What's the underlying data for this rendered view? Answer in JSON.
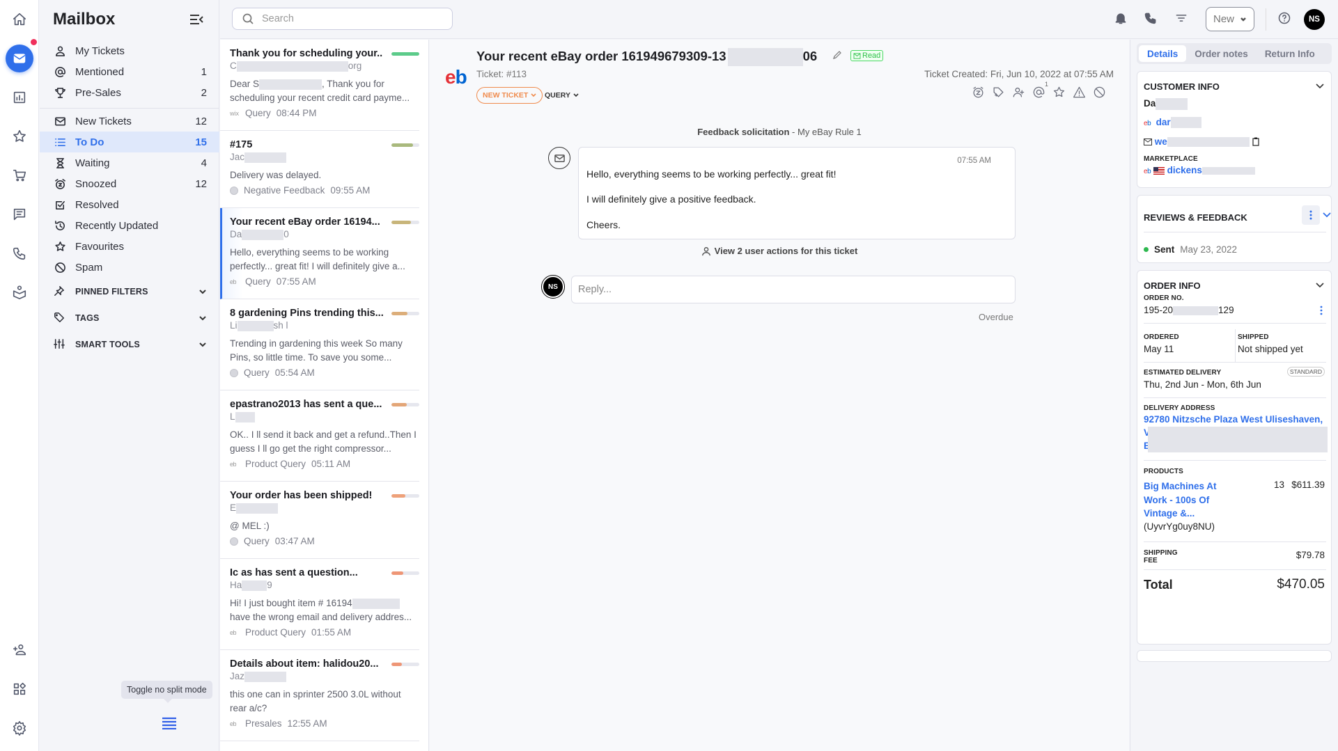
{
  "rail": {
    "items": [
      {
        "name": "home-icon"
      },
      {
        "name": "mailbox-icon",
        "active": true,
        "notification": true
      },
      {
        "name": "reports-icon"
      },
      {
        "name": "reviews-star-icon"
      },
      {
        "name": "cart-icon"
      },
      {
        "name": "chat-icon"
      },
      {
        "name": "phone-icon"
      },
      {
        "name": "knowledge-icon"
      }
    ],
    "bottom": [
      {
        "name": "add-user-icon"
      },
      {
        "name": "apps-icon"
      },
      {
        "name": "settings-icon"
      }
    ]
  },
  "sidebar": {
    "title": "Mailbox",
    "groups": [
      [
        {
          "label": "My Tickets",
          "icon": "user-icon",
          "count": ""
        },
        {
          "label": "Mentioned",
          "icon": "at-icon",
          "count": "1"
        },
        {
          "label": "Pre-Sales",
          "icon": "trophy-icon",
          "count": "2"
        }
      ],
      [
        {
          "label": "New Tickets",
          "icon": "envelope-icon",
          "count": "12"
        },
        {
          "label": "To Do",
          "icon": "list-icon",
          "count": "15",
          "selected": true
        },
        {
          "label": "Waiting",
          "icon": "hourglass-icon",
          "count": "4"
        },
        {
          "label": "Snoozed",
          "icon": "snooze-icon",
          "count": "12"
        },
        {
          "label": "Resolved",
          "icon": "resolved-icon",
          "count": ""
        },
        {
          "label": "Recently Updated",
          "icon": "history-icon",
          "count": ""
        },
        {
          "label": "Favourites",
          "icon": "star-icon",
          "count": ""
        },
        {
          "label": "Spam",
          "icon": "spam-icon",
          "count": ""
        }
      ]
    ],
    "sections": [
      {
        "label": "PINNED FILTERS",
        "icon": "pin-icon"
      },
      {
        "label": "TAGS",
        "icon": "tag-icon"
      },
      {
        "label": "SMART TOOLS",
        "icon": "sliders-icon"
      }
    ],
    "tooltip": "Toggle no split mode"
  },
  "topbar": {
    "search_placeholder": "Search",
    "new_label": "New",
    "avatar_initials": "NS"
  },
  "tickets": [
    {
      "title": "Thank you for scheduling your...",
      "from": "C",
      "from_tail": "org",
      "preview": ", Thank you for scheduling your recent credit card payme...",
      "preview_lead": "Dear S",
      "source": "wix",
      "category": "Query",
      "time": "08:44 PM",
      "priority_color": "#5ccb8a",
      "priority": 1.0
    },
    {
      "title": "#175",
      "from": "Jac",
      "from_tail": "",
      "preview": "Delivery was delayed.",
      "preview_lead": "",
      "source": "globe",
      "category": "Negative Feedback",
      "time": "09:55 AM",
      "priority_color": "#a9b97d",
      "priority": 0.78
    },
    {
      "title": "Your recent eBay order 16194...",
      "from": "Da",
      "from_tail": "0",
      "preview": "Hello, everything seems to be working perfectly... great fit! I will definitely give a...",
      "preview_lead": "",
      "source": "eb",
      "category": "Query",
      "time": "07:55 AM",
      "priority_color": "#c8b57a",
      "priority": 0.7,
      "selected": true
    },
    {
      "title": "8 gardening Pins trending this...",
      "from": "Li",
      "from_tail": "sh l",
      "preview": "Trending in gardening this week So many Pins, so little time. To save you some...",
      "preview_lead": "",
      "source": "globe",
      "category": "Query",
      "time": "05:54 AM",
      "priority_color": "#dcae7a",
      "priority": 0.58
    },
    {
      "title": "epastrano2013 has sent a que...",
      "from": "L",
      "from_tail": "",
      "preview": "OK.. I ll send it back and get a refund..Then I guess I ll go get the right compressor...",
      "preview_lead": "",
      "source": "eb",
      "category": "Product Query",
      "time": "05:11 AM",
      "priority_color": "#e3a678",
      "priority": 0.56
    },
    {
      "title": "Your order has been shipped!",
      "from": "E",
      "from_tail": "",
      "preview": "@ MEL :)",
      "preview_lead": "",
      "source": "globe",
      "category": "Query",
      "time": "03:47 AM",
      "priority_color": "#eea17a",
      "priority": 0.5
    },
    {
      "title": "Ic        as has sent a question...",
      "from": "Ha",
      "from_tail": "9",
      "preview": "have the wrong email and delivery addres...",
      "preview_lead": "Hi! I just bought item # 16194",
      "source": "eb",
      "category": "Product Query",
      "time": "01:55 AM",
      "priority_color": "#ee9676",
      "priority": 0.42
    },
    {
      "title": "Details about item: halidou20...",
      "from": "Jaz",
      "from_tail": "",
      "preview": "this one can in sprinter 2500 3.0L without rear a/c?",
      "preview_lead": "",
      "source": "eb",
      "category": "Presales",
      "time": "12:55 AM",
      "priority_color": "#ee9676",
      "priority": 0.38
    }
  ],
  "ticket": {
    "subject": "Your recent eBay order 161949679309-13",
    "subject_tail": "06",
    "read_label": "Read",
    "number": "Ticket: #113",
    "created": "Ticket Created: Fri, Jun 10, 2022 at 07:55 AM",
    "status": "NEW TICKET",
    "type": "QUERY",
    "mention_count": "1",
    "actions": [
      "snooze-icon",
      "tag-add-icon",
      "assign-user-icon",
      "mention-icon",
      "favourite-star-icon",
      "warning-icon",
      "spam-block-icon"
    ],
    "rule_bold": "Feedback solicitation",
    "rule_rest": " - My eBay Rule 1",
    "message": {
      "time": "07:55 AM",
      "lines": [
        "Hello, everything seems to be working perfectly... great fit!",
        "I will definitely give a positive feedback.",
        "Cheers."
      ]
    },
    "user_actions": "View 2 user actions for this ticket",
    "reply_initials": "NS",
    "reply_placeholder": "Reply...",
    "sla": "Overdue"
  },
  "details": {
    "tabs": [
      "Details",
      "Order notes",
      "Return Info"
    ],
    "customer": {
      "header": "CUSTOMER INFO",
      "name": "Da",
      "ebay_user": "dar",
      "email": "we",
      "marketplace_label": "MARKETPLACE",
      "marketplace": "dickens"
    },
    "reviews": {
      "header": "REVIEWS & FEEDBACK",
      "status": "Sent",
      "date": "May 23, 2022",
      "status_color": "#2eb84f"
    },
    "order": {
      "header": "ORDER INFO",
      "order_no_label": "ORDER NO.",
      "order_no_head": "195-20",
      "order_no_tail": "129",
      "ordered_label": "ORDERED",
      "ordered": "May 11",
      "shipped_label": "SHIPPED",
      "shipped": "Not shipped yet",
      "est_label": "ESTIMATED DELIVERY",
      "est": "Thu, 2nd Jun - Mon, 6th Jun",
      "shipping_method": "STANDARD",
      "address_label": "DELIVERY ADDRESS",
      "address": "92780 Nitzsche Plaza West Uliseshaven,",
      "address_l2": "V",
      "address_l3": "E",
      "products_label": "PRODUCTS",
      "product_name_1": "Big Machines At",
      "product_name_2": "Work - 100s Of",
      "product_name_3": "Vintage &...",
      "product_sku": "(UyvrYg0uy8NU)",
      "product_qty": "13",
      "product_price": "$611.39",
      "shipping_label_1": "SHIPPING",
      "shipping_label_2": "FEE",
      "shipping": "$79.78",
      "total_label": "Total",
      "total": "$470.05"
    }
  },
  "colors": {
    "accent": "#2f6fea",
    "status_new": "#f08a4b",
    "read": "#2ec24a",
    "notification": "#f0305c"
  }
}
